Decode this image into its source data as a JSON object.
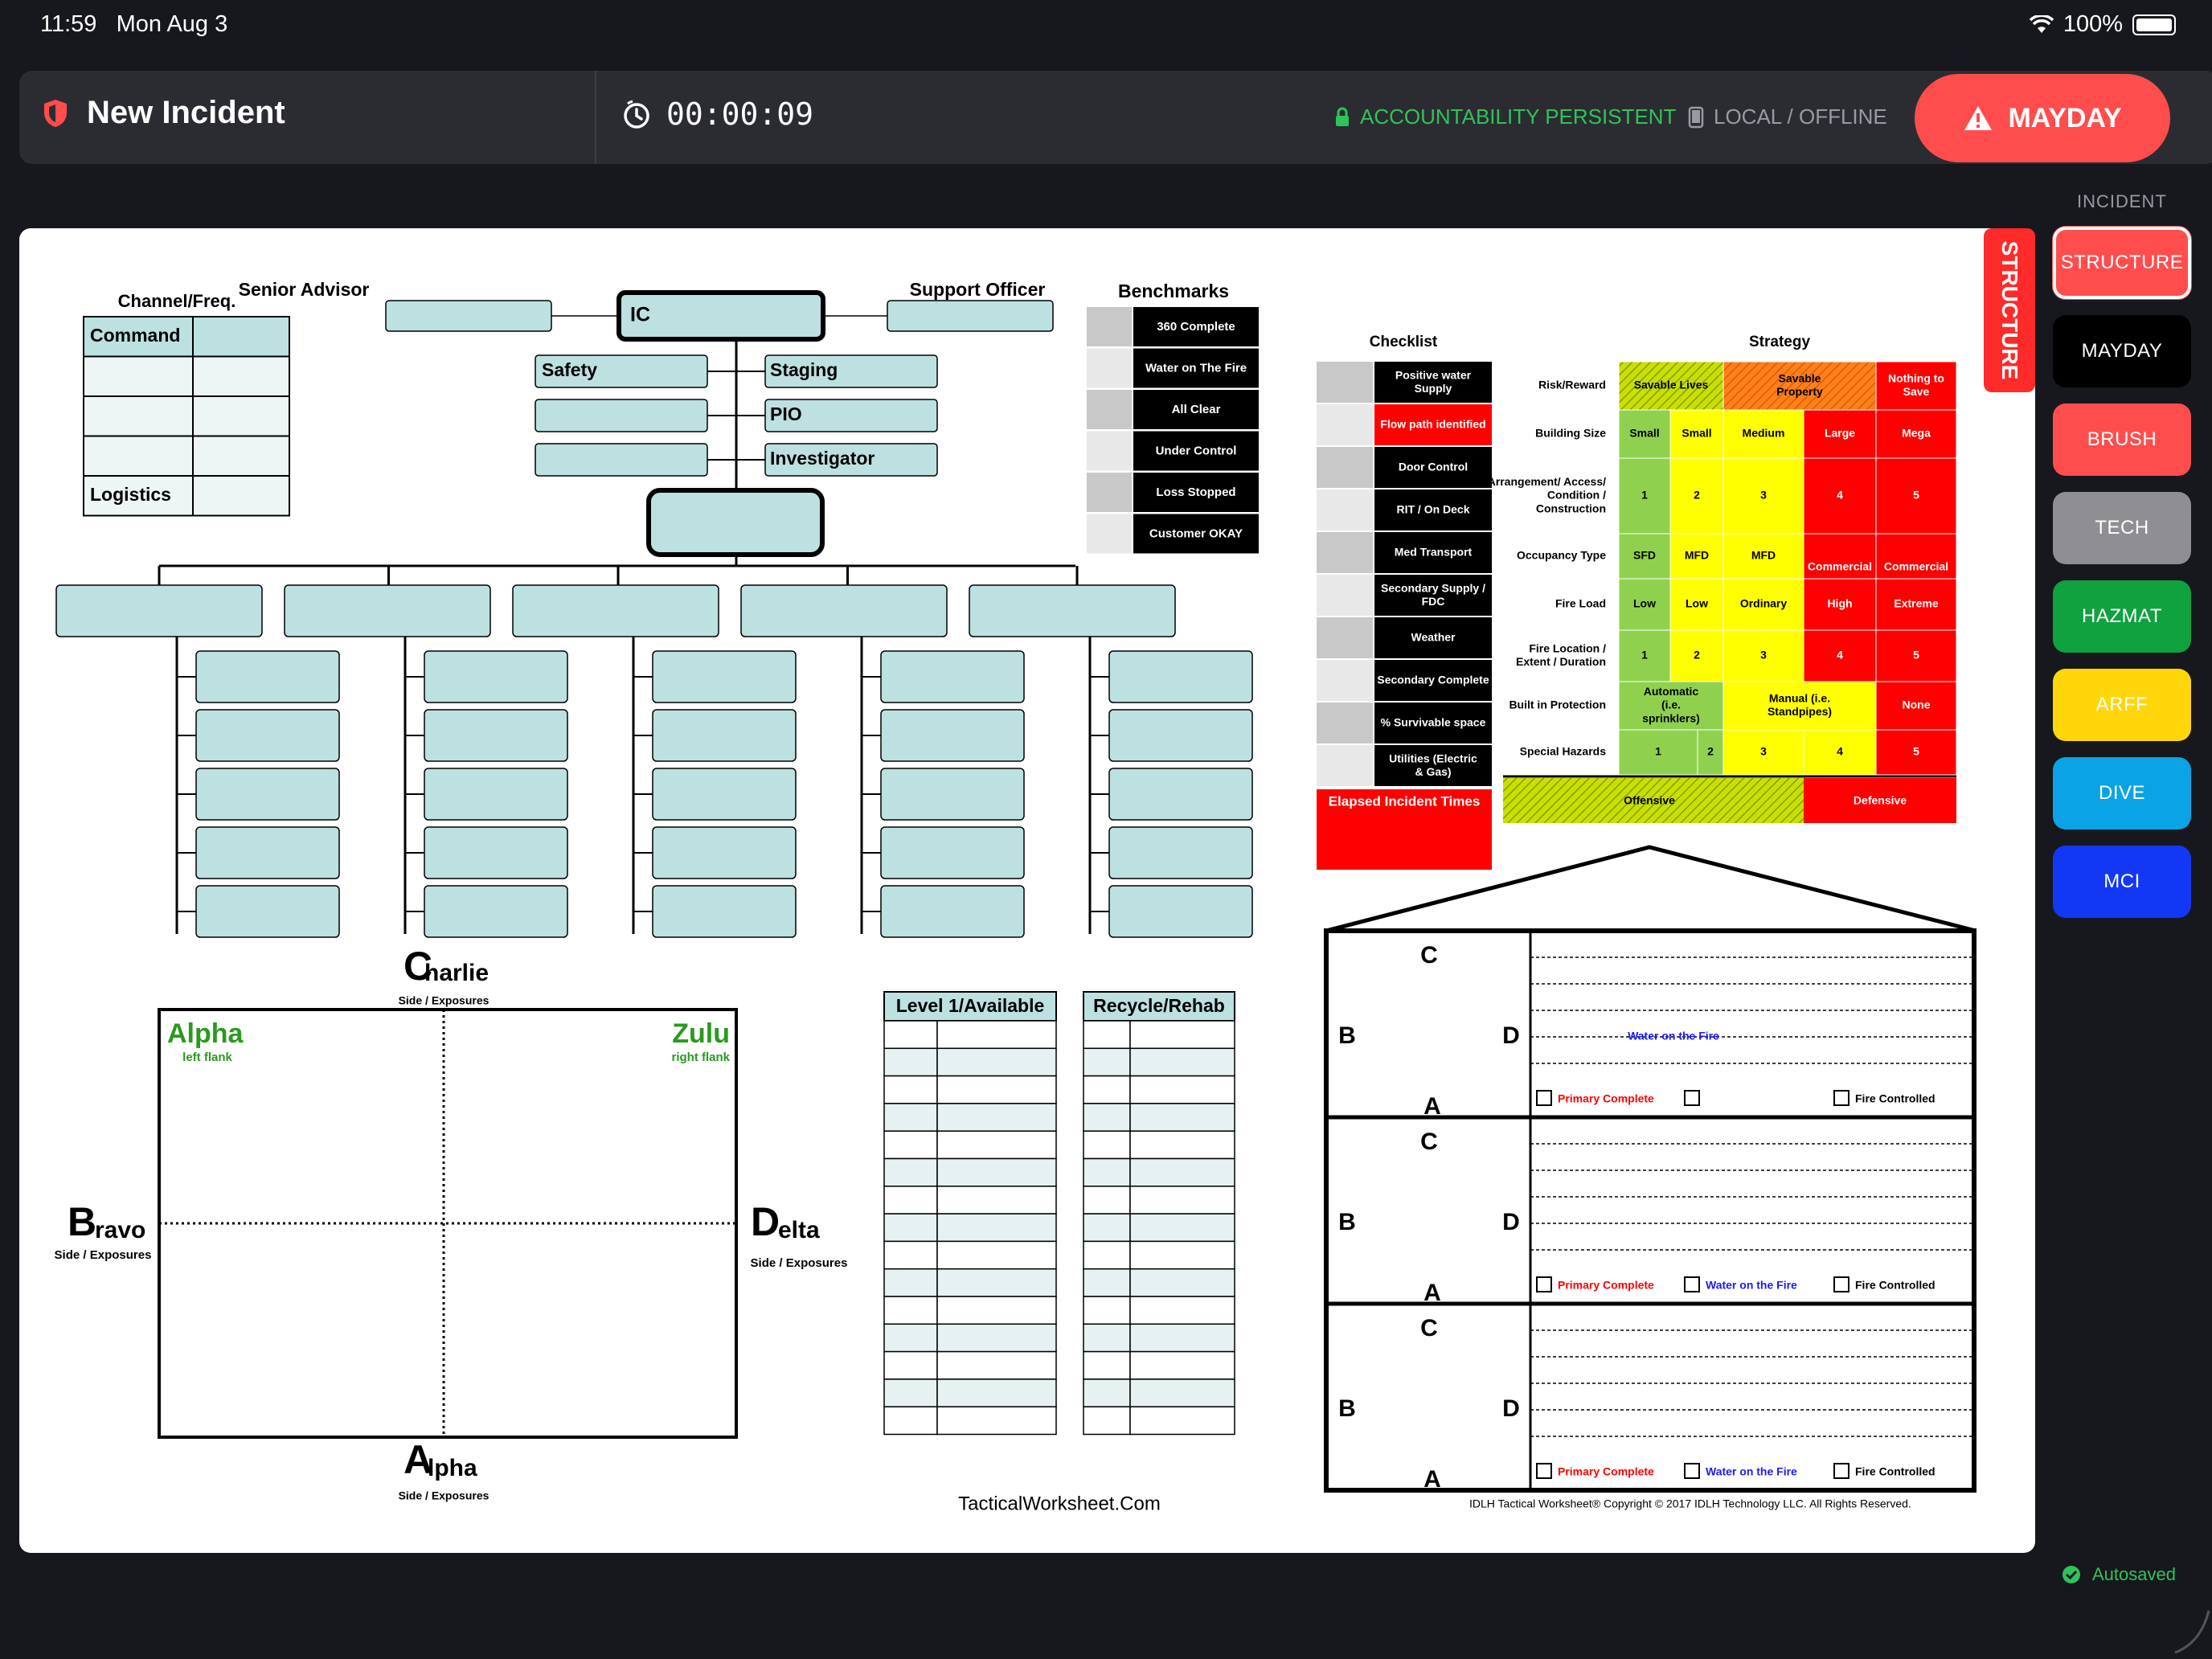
{
  "status_bar": {
    "time": "11:59",
    "date": "Mon Aug 3",
    "battery": "100%"
  },
  "header": {
    "title": "New Incident",
    "timer": "00:00:09",
    "accountability": "ACCOUNTABILITY PERSISTENT",
    "mode": "LOCAL / OFFLINE",
    "mayday_label": "MAYDAY"
  },
  "colors": {
    "accent": "#ff4d4d",
    "success": "#2fc35b",
    "topbar": "#2b2c31",
    "background": "#17181d",
    "cell": "#bde0e1"
  },
  "incident_rail": {
    "label": "INCIDENT",
    "items": [
      {
        "label": "STRUCTURE",
        "color": "#ff4d4d",
        "selected": true
      },
      {
        "label": "MAYDAY",
        "color": "#000000"
      },
      {
        "label": "BRUSH",
        "color": "#ff4d4d"
      },
      {
        "label": "TECH",
        "color": "#8e8e93"
      },
      {
        "label": "HAZMAT",
        "color": "#0fa23f"
      },
      {
        "label": "ARFF",
        "color": "#ffd60a"
      },
      {
        "label": "DIVE",
        "color": "#0aa3e6"
      },
      {
        "label": "MCI",
        "color": "#1338f5"
      }
    ]
  },
  "side_tab": "STRUCTURE",
  "autosave": "Autosaved",
  "worksheet": {
    "channel": {
      "title": "Channel/Freq.",
      "rows": [
        "Command",
        "",
        "",
        "",
        "Logistics"
      ]
    },
    "senior_advisor": "Senior Advisor",
    "support_officer": "Support Officer",
    "ic": "IC",
    "ic_left": [
      "Safety",
      "",
      ""
    ],
    "ic_right": [
      "Staging",
      "PIO",
      "Investigator"
    ],
    "benchmarks": {
      "title": "Benchmarks",
      "items": [
        "360 Complete",
        "Water on The Fire",
        "All Clear",
        "Under Control",
        "Loss Stopped",
        "Customer OKAY"
      ]
    },
    "checklist": {
      "title": "Checklist",
      "items": [
        "Positive water Supply",
        "Flow path identified",
        "Door Control",
        "RIT / On Deck",
        "Med Transport",
        "Secondary Supply / FDC",
        "Weather",
        "Secondary Complete",
        "% Survivable space",
        "Utilities (Electric & Gas)"
      ],
      "elapsed": "Elapsed Incident Times"
    },
    "strategy": {
      "title": "Strategy",
      "rows": [
        {
          "label": "Risk/Reward",
          "cells": [
            {
              "t": "Savable Lives",
              "c": "#c8e000",
              "span": 2,
              "hatch": "g"
            },
            {
              "t": "Savable Property",
              "c": "#ff7f1c",
              "span": 2,
              "hatch": "o"
            },
            {
              "t": "Nothing to Save",
              "c": "#ff0000"
            }
          ]
        },
        {
          "label": "Building Size",
          "cells": [
            {
              "t": "Small",
              "c": "#8fd14f"
            },
            {
              "t": "Small",
              "c": "#ffff00"
            },
            {
              "t": "Medium",
              "c": "#ffff00"
            },
            {
              "t": "Large",
              "c": "#ff0000"
            },
            {
              "t": "Mega",
              "c": "#ff0000"
            }
          ]
        },
        {
          "label": "Arrangement/ Access/ Condition / Construction",
          "cells": [
            {
              "t": "1",
              "c": "#8fd14f"
            },
            {
              "t": "2",
              "c": "#ffff00"
            },
            {
              "t": "3",
              "c": "#ffff00"
            },
            {
              "t": "4",
              "c": "#ff0000"
            },
            {
              "t": "5",
              "c": "#ff0000"
            }
          ]
        },
        {
          "label": "Occupancy Type",
          "cells": [
            {
              "t": "SFD",
              "c": "#8fd14f"
            },
            {
              "t": "MFD",
              "c": "#ffff00"
            },
            {
              "t": "MFD",
              "c": "#ffff00"
            },
            {
              "t": "Commercial",
              "c": "#ff0000"
            },
            {
              "t": "Commercial",
              "c": "#ff0000"
            }
          ]
        },
        {
          "label": "Fire Load",
          "cells": [
            {
              "t": "Low",
              "c": "#8fd14f"
            },
            {
              "t": "Low",
              "c": "#ffff00"
            },
            {
              "t": "Ordinary",
              "c": "#ffff00"
            },
            {
              "t": "High",
              "c": "#ff0000"
            },
            {
              "t": "Extreme",
              "c": "#ff0000"
            }
          ]
        },
        {
          "label": "Fire Location / Extent / Duration",
          "cells": [
            {
              "t": "1",
              "c": "#8fd14f"
            },
            {
              "t": "2",
              "c": "#ffff00"
            },
            {
              "t": "3",
              "c": "#ffff00"
            },
            {
              "t": "4",
              "c": "#ff0000"
            },
            {
              "t": "5",
              "c": "#ff0000"
            }
          ]
        },
        {
          "label": "Built in Protection",
          "cells": [
            {
              "t": "Automatic (i.e. sprinklers)",
              "c": "#8fd14f",
              "span": 2
            },
            {
              "t": "Manual (i.e. Standpipes)",
              "c": "#ffff00",
              "span": 2
            },
            {
              "t": "None",
              "c": "#ff0000"
            }
          ]
        },
        {
          "label": "Special Hazards",
          "cells": [
            {
              "t": "1",
              "c": "#8fd14f"
            },
            {
              "t": "2",
              "c": "#8fd14f"
            },
            {
              "t": "3",
              "c": "#ffff00"
            },
            {
              "t": "4",
              "c": "#ffff00"
            },
            {
              "t": "5",
              "c": "#ff0000"
            }
          ]
        }
      ],
      "offensive": "Offensive",
      "defensive": "Defensive"
    },
    "sides": {
      "charlie": "Charlie",
      "bravo": "Bravo",
      "delta": "Delta",
      "alpha": "Alpha",
      "sub": "Side / Exposures",
      "alpha_corner": "Alpha",
      "alpha_corner_sub": "left flank",
      "zulu": "Zulu",
      "zulu_sub": "right flank"
    },
    "level1": "Level 1/Available",
    "recycle": "Recycle/Rehab",
    "website": "TacticalWorksheet.Com",
    "building": {
      "sections": [
        {
          "C": "C",
          "B": "B",
          "D": "D",
          "A": "A",
          "note": "Water on the Fire",
          "check1": "Primary Complete",
          "check2": "",
          "check3": "Fire Controlled"
        },
        {
          "C": "C",
          "B": "B",
          "D": "D",
          "A": "A",
          "note": "",
          "check1": "Primary Complete",
          "check2": "Water on the Fire",
          "check3": "Fire Controlled"
        },
        {
          "C": "C",
          "B": "B",
          "D": "D",
          "A": "A",
          "note": "",
          "check1": "Primary Complete",
          "check2": "Water on the Fire",
          "check3": "Fire Controlled"
        }
      ]
    },
    "copyright": "IDLH Tactical Worksheet®  Copyright © 2017 IDLH Technology LLC. All Rights Reserved."
  }
}
